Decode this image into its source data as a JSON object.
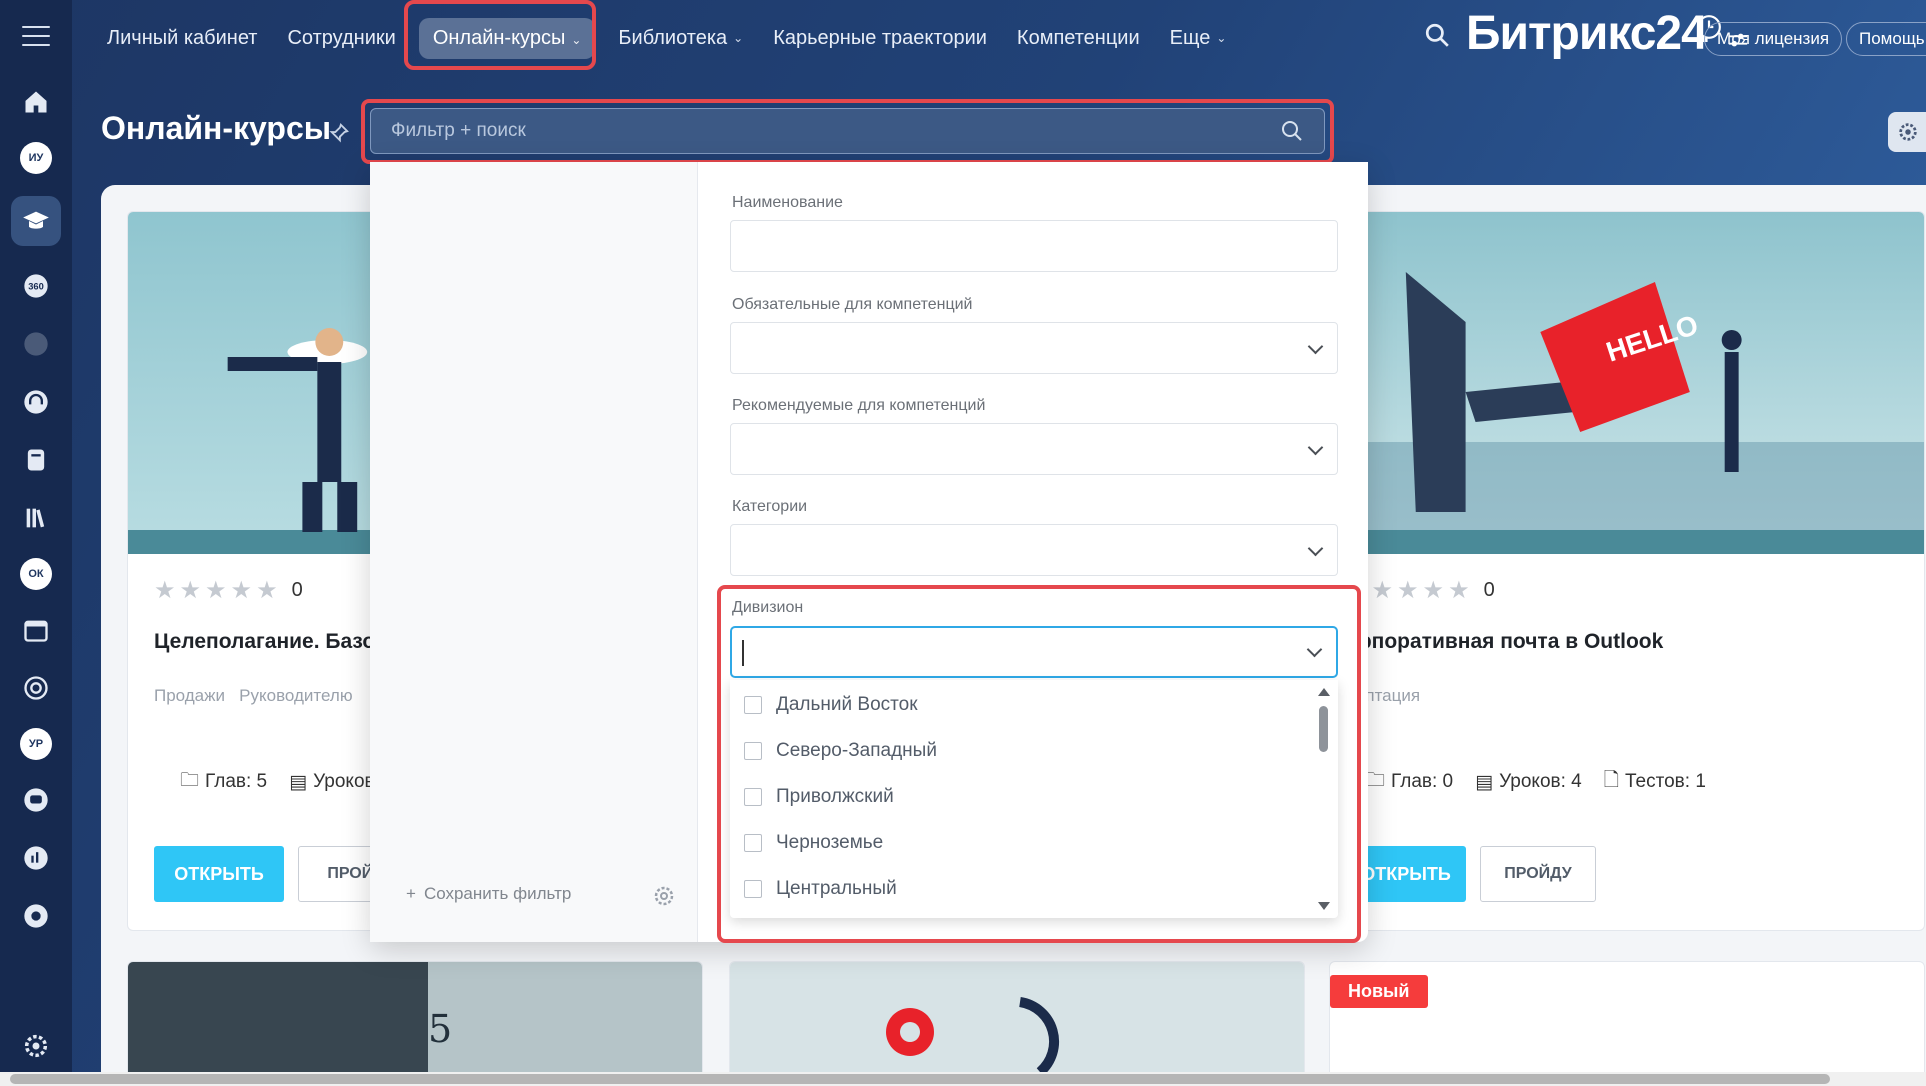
{
  "nav": {
    "items": [
      {
        "label": "Личный кабинет"
      },
      {
        "label": "Сотрудники"
      },
      {
        "label": "Онлайн-курсы"
      },
      {
        "label": "Библиотека"
      },
      {
        "label": "Карьерные траектории"
      },
      {
        "label": "Компетенции"
      },
      {
        "label": "Еще"
      }
    ],
    "brand": "Битрикс24",
    "license": "Моя лицензия",
    "help": "Помощь"
  },
  "sidebar": {
    "badges": [
      "ИУ",
      "ОК",
      "УР"
    ]
  },
  "page": {
    "title": "Онлайн-курсы",
    "search_placeholder": "Фильтр + поиск"
  },
  "filter": {
    "save_label": "Сохранить фильтр",
    "fields": {
      "name": "Наименование",
      "required": "Обязательные для компетенций",
      "recommended": "Рекомендуемые для компетенций",
      "categories": "Категории",
      "division": "Дивизион"
    },
    "division_options": [
      "Дальний Восток",
      "Северо-Западный",
      "Приволжский",
      "Черноземье",
      "Центральный"
    ]
  },
  "cards": [
    {
      "rating": "0",
      "title": "Целеполагание. Базов",
      "tags": [
        "Продажи",
        "Руководителю"
      ],
      "chapters": "Глав: 5",
      "lessons": "Уроков:",
      "open": "ОТКРЫТЬ",
      "pass": "ПРОЙД"
    },
    {
      "rating": "0",
      "title": "орпоративная почта в Outlook",
      "tags": [
        "даптация"
      ],
      "chapters": "Глав: 0",
      "lessons": "Уроков: 4",
      "tests": "Тестов: 1",
      "open": "ОТКРЫТЬ",
      "pass": "ПРОЙДУ",
      "image_text": "HELLO"
    }
  ],
  "new_badge": "Новый",
  "colors": {
    "accent": "#2fc6f6",
    "highlight": "#e5484d",
    "nav_bg": "#214277",
    "sidebar_bg": "#16294f"
  }
}
